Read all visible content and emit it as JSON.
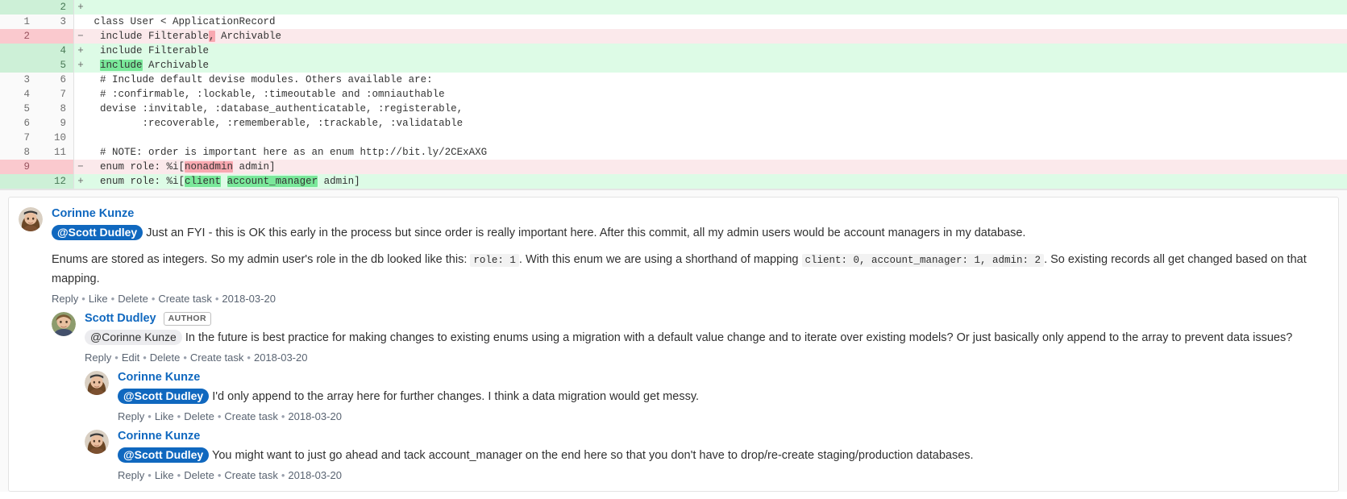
{
  "diff": {
    "rows": [
      {
        "old": "",
        "new": "2",
        "marker": "+",
        "type": "add",
        "segments": [
          {
            "t": "",
            "hl": null
          }
        ]
      },
      {
        "old": "1",
        "new": "3",
        "marker": "",
        "type": "ctx",
        "segments": [
          {
            "t": " class User < ApplicationRecord",
            "hl": null
          }
        ]
      },
      {
        "old": "2",
        "new": "",
        "marker": "−",
        "type": "del",
        "segments": [
          {
            "t": "  include Filterable",
            "hl": null
          },
          {
            "t": ",",
            "hl": "del"
          },
          {
            "t": " Archivable",
            "hl": null
          }
        ]
      },
      {
        "old": "",
        "new": "4",
        "marker": "+",
        "type": "add",
        "segments": [
          {
            "t": "  include Filterable",
            "hl": null
          }
        ]
      },
      {
        "old": "",
        "new": "5",
        "marker": "+",
        "type": "add",
        "segments": [
          {
            "t": "  ",
            "hl": null
          },
          {
            "t": "include",
            "hl": "add"
          },
          {
            "t": " Archivable",
            "hl": null
          }
        ]
      },
      {
        "old": "3",
        "new": "6",
        "marker": "",
        "type": "ctx",
        "segments": [
          {
            "t": "  # Include default devise modules. Others available are:",
            "hl": null
          }
        ]
      },
      {
        "old": "4",
        "new": "7",
        "marker": "",
        "type": "ctx",
        "segments": [
          {
            "t": "  # :confirmable, :lockable, :timeoutable and :omniauthable",
            "hl": null
          }
        ]
      },
      {
        "old": "5",
        "new": "8",
        "marker": "",
        "type": "ctx",
        "segments": [
          {
            "t": "  devise :invitable, :database_authenticatable, :registerable,",
            "hl": null
          }
        ]
      },
      {
        "old": "6",
        "new": "9",
        "marker": "",
        "type": "ctx",
        "segments": [
          {
            "t": "         :recoverable, :rememberable, :trackable, :validatable",
            "hl": null
          }
        ]
      },
      {
        "old": "7",
        "new": "10",
        "marker": "",
        "type": "ctx",
        "segments": [
          {
            "t": "",
            "hl": null
          }
        ]
      },
      {
        "old": "8",
        "new": "11",
        "marker": "",
        "type": "ctx",
        "segments": [
          {
            "t": "  # NOTE: order is important here as an enum http://bit.ly/2CExAXG",
            "hl": null
          }
        ]
      },
      {
        "old": "9",
        "new": "",
        "marker": "−",
        "type": "del",
        "segments": [
          {
            "t": "  enum role: %i[",
            "hl": null
          },
          {
            "t": "nonadmin",
            "hl": "del"
          },
          {
            "t": " admin]",
            "hl": null
          }
        ]
      },
      {
        "old": "",
        "new": "12",
        "marker": "+",
        "type": "add",
        "segments": [
          {
            "t": "  enum role: %i[",
            "hl": null
          },
          {
            "t": "client",
            "hl": "add"
          },
          {
            "t": " ",
            "hl": null
          },
          {
            "t": "account_manager",
            "hl": "add"
          },
          {
            "t": " admin]",
            "hl": null
          }
        ]
      }
    ]
  },
  "notes": [
    {
      "level": 1,
      "avatar": "woman-avatar",
      "author": "Corinne Kunze",
      "badge": null,
      "mention": {
        "text": "@Scott Dudley",
        "style": "self"
      },
      "paragraphs": [
        {
          "parts": [
            {
              "type": "text",
              "value": "Just an FYI - this is OK this early in the process but since order is really important here. After this commit, all my admin users would be account managers in my database."
            }
          ]
        },
        {
          "parts": [
            {
              "type": "text",
              "value": "Enums are stored as integers. So my admin user's role in the db looked like this: "
            },
            {
              "type": "code",
              "value": "role: 1"
            },
            {
              "type": "text",
              "value": ". With this enum we are using a shorthand of mapping "
            },
            {
              "type": "code",
              "value": "client: 0, account_manager: 1, admin: 2"
            },
            {
              "type": "text",
              "value": ". So existing records all get changed based on that mapping."
            }
          ]
        }
      ],
      "actions": [
        "Reply",
        "Like",
        "Delete",
        "Create task"
      ],
      "timestamp": "2018-03-20"
    },
    {
      "level": 2,
      "avatar": "man-avatar",
      "author": "Scott Dudley",
      "badge": "AUTHOR",
      "mention": {
        "text": "@Corinne Kunze",
        "style": "other"
      },
      "paragraphs": [
        {
          "parts": [
            {
              "type": "text",
              "value": "In the future is best practice for making changes to existing enums using a migration with a default value change and to iterate over existing models? Or just basically only append to the array to prevent data issues?"
            }
          ]
        }
      ],
      "actions": [
        "Reply",
        "Edit",
        "Delete",
        "Create task"
      ],
      "timestamp": "2018-03-20"
    },
    {
      "level": 3,
      "avatar": "woman-avatar",
      "author": "Corinne Kunze",
      "badge": null,
      "mention": {
        "text": "@Scott Dudley",
        "style": "self"
      },
      "paragraphs": [
        {
          "parts": [
            {
              "type": "text",
              "value": "I'd only append to the array here for further changes. I think a data migration would get messy."
            }
          ]
        }
      ],
      "actions": [
        "Reply",
        "Like",
        "Delete",
        "Create task"
      ],
      "timestamp": "2018-03-20"
    },
    {
      "level": 3,
      "avatar": "woman-avatar",
      "author": "Corinne Kunze",
      "badge": null,
      "mention": {
        "text": "@Scott Dudley",
        "style": "self"
      },
      "paragraphs": [
        {
          "parts": [
            {
              "type": "text",
              "value": "You might want to just go ahead and tack account_manager on the end here so that you don't have to drop/re-create staging/production databases."
            }
          ]
        }
      ],
      "actions": [
        "Reply",
        "Like",
        "Delete",
        "Create task"
      ],
      "timestamp": "2018-03-20"
    }
  ],
  "colors": {
    "add_bg": "#ddfbe6",
    "del_bg": "#fbe9eb",
    "add_hl": "#7ae89a",
    "del_hl": "#f8a8b0",
    "link": "#1068bf",
    "mention_self_bg": "#1068bf"
  }
}
